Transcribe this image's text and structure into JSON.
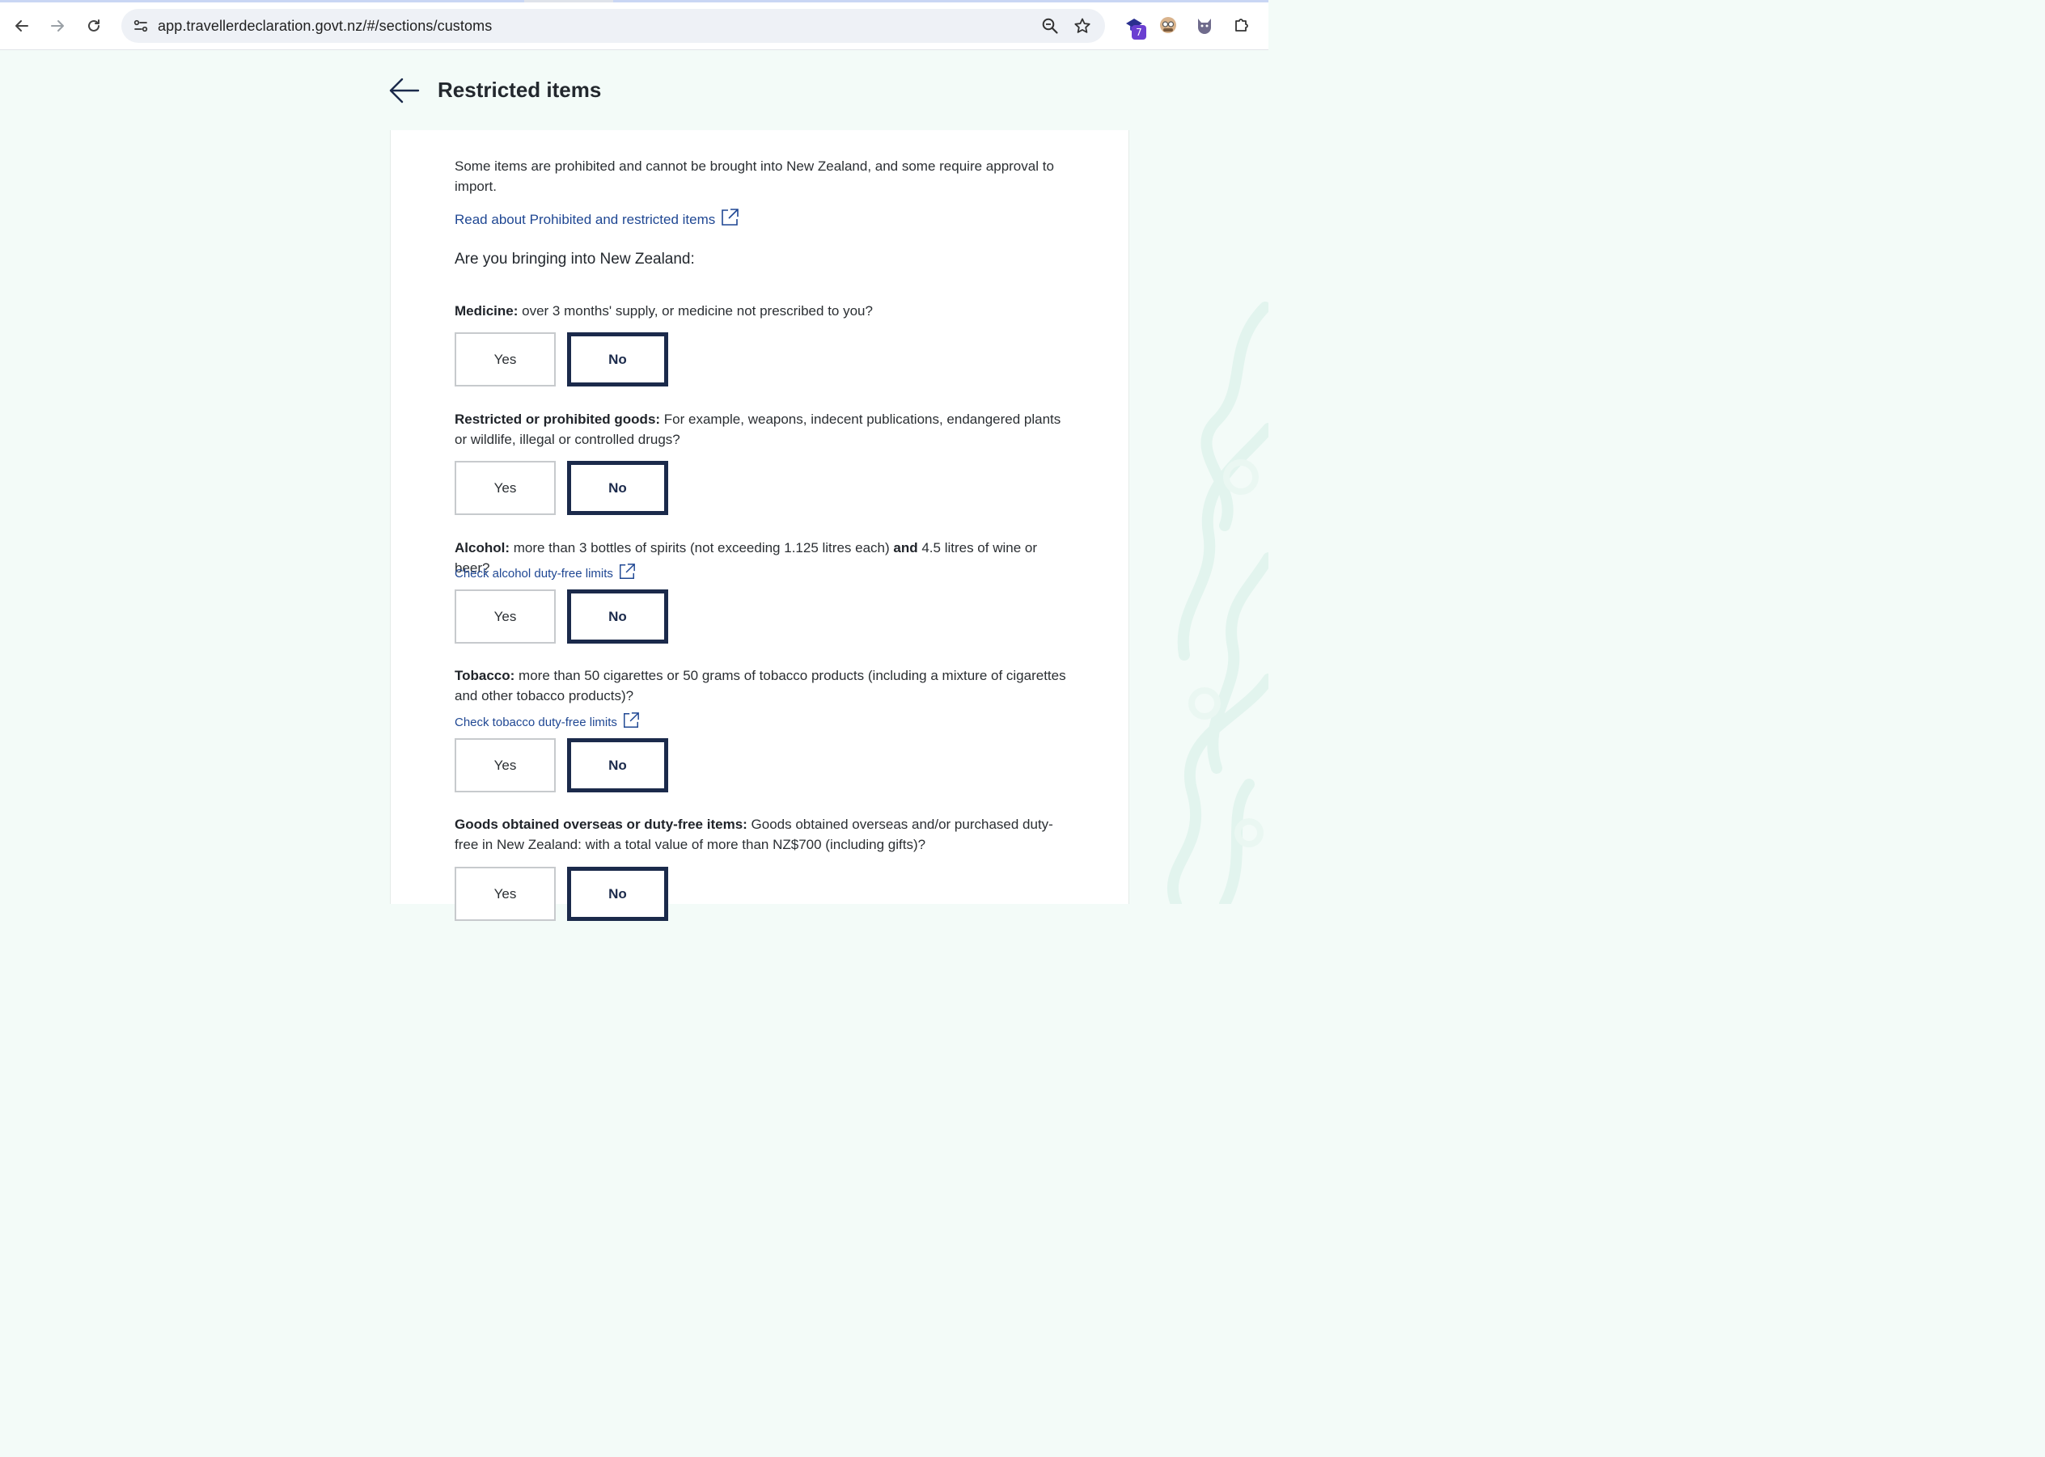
{
  "browser": {
    "url": "app.travellerdeclaration.govt.nz/#/sections/customs",
    "extension_badge": "7",
    "icons": [
      "back-icon",
      "forward-icon",
      "reload-icon",
      "site-settings-icon",
      "zoom-icon",
      "bookmark-star-icon",
      "extension-icon",
      "profile-avatar-icon",
      "cat-avatar-icon",
      "puzzle-extensions-icon"
    ]
  },
  "page": {
    "title": "Restricted items",
    "intro": "Some items are prohibited and cannot be brought into New Zealand, and some require approval to import.",
    "prohibited_link": "Read about Prohibited and restricted items",
    "lead_question": "Are you bringing into New Zealand:"
  },
  "questions": [
    {
      "label_bold": "Medicine:",
      "label_text": " over 3 months' supply, or medicine not prescribed to you?",
      "yes": "Yes",
      "no": "No",
      "selected": "No"
    },
    {
      "label_bold": "Restricted or prohibited goods:",
      "label_text": " For example, weapons, indecent publications, endangered plants or wildlife, illegal or controlled drugs?",
      "yes": "Yes",
      "no": "No",
      "selected": "No"
    },
    {
      "label_bold": "Alcohol:",
      "label_text_1": " more than 3 bottles of spirits (not exceeding 1.125 litres each) ",
      "label_bold_2": "and",
      "label_text_2": " 4.5 litres of wine or beer?",
      "link": "Check alcohol duty-free limits",
      "yes": "Yes",
      "no": "No",
      "selected": "No"
    },
    {
      "label_bold": "Tobacco:",
      "label_text": " more than 50 cigarettes or 50 grams of tobacco products (including a mixture of cigarettes and other tobacco products)?",
      "link": "Check tobacco duty-free limits",
      "yes": "Yes",
      "no": "No",
      "selected": "No"
    },
    {
      "label_bold": "Goods obtained overseas or duty-free items:",
      "label_text": " Goods obtained overseas and/or purchased duty-free in New Zealand: with a total value of more than NZ$700 (including gifts)?",
      "yes": "Yes",
      "no": "No",
      "selected": "No"
    }
  ],
  "colors": {
    "page_background": "#f3fbf8",
    "link": "#1f4793",
    "selected_border": "#1b2a4b",
    "unselected_border": "#c7cacd"
  }
}
